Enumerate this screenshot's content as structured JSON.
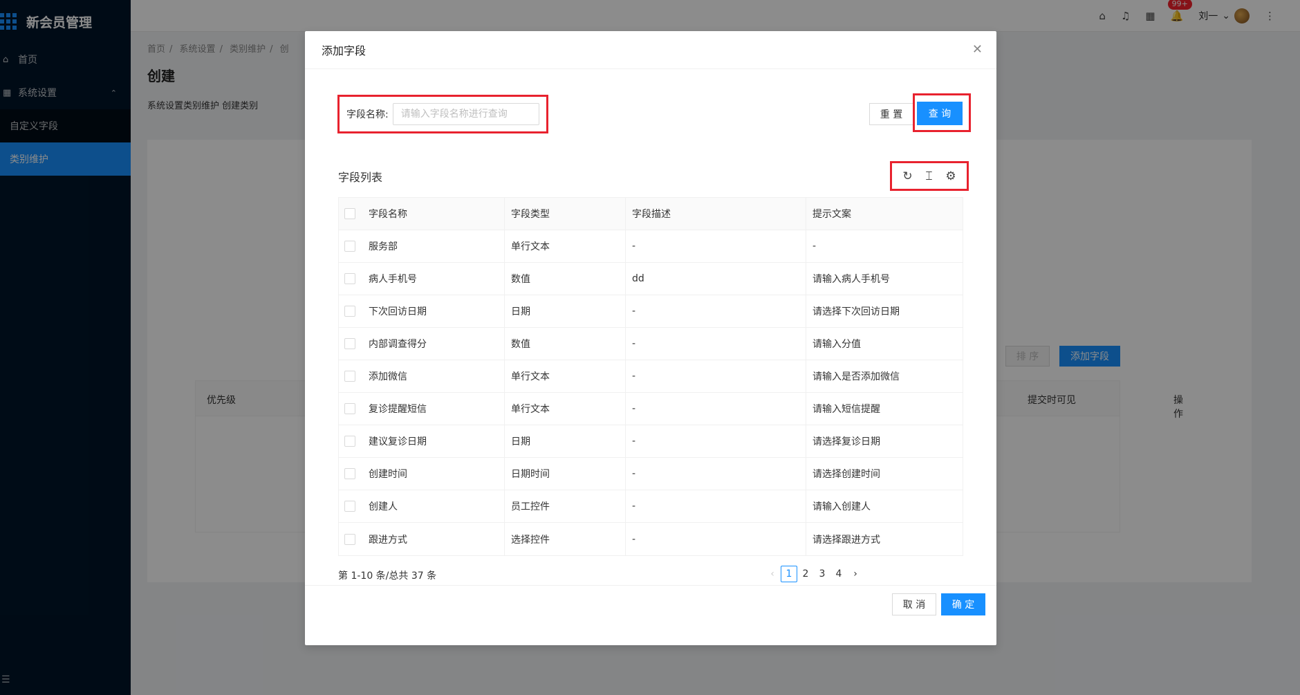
{
  "app": {
    "title": "新会员管理"
  },
  "sidebar": {
    "items": [
      {
        "label": "首页",
        "icon": "home-icon"
      },
      {
        "label": "系统设置",
        "icon": "settings-icon"
      },
      {
        "label": "自定义字段"
      },
      {
        "label": "类别维护"
      }
    ]
  },
  "header": {
    "badge": "99+",
    "user_name": "刘一"
  },
  "page": {
    "breadcrumb": [
      "首页",
      "系统设置",
      "类别维护",
      "创"
    ],
    "title": "创建",
    "subtitle": "系统设置类别维护 创建类别",
    "sort_label": "排 序",
    "add_field_label": "添加字段",
    "table_headers": {
      "priority": "优先级",
      "visible": "提交时可见",
      "action": "操作"
    }
  },
  "modal": {
    "title": "添加字段",
    "search": {
      "label": "字段名称:",
      "placeholder": "请输入字段名称进行查询",
      "value": ""
    },
    "reset_label": "重 置",
    "query_label": "查 询",
    "list_title": "字段列表",
    "columns": [
      "字段名称",
      "字段类型",
      "字段描述",
      "提示文案"
    ],
    "rows": [
      [
        "服务部",
        "单行文本",
        "-",
        "-"
      ],
      [
        "病人手机号",
        "数值",
        "dd",
        "请输入病人手机号"
      ],
      [
        "下次回访日期",
        "日期",
        "-",
        "请选择下次回访日期"
      ],
      [
        "内部调查得分",
        "数值",
        "-",
        "请输入分值"
      ],
      [
        "添加微信",
        "单行文本",
        "-",
        "请输入是否添加微信"
      ],
      [
        "复诊提醒短信",
        "单行文本",
        "-",
        "请输入短信提醒"
      ],
      [
        "建议复诊日期",
        "日期",
        "-",
        "请选择复诊日期"
      ],
      [
        "创建时间",
        "日期时间",
        "-",
        "请选择创建时间"
      ],
      [
        "创建人",
        "员工控件",
        "-",
        "请输入创建人"
      ],
      [
        "跟进方式",
        "选择控件",
        "-",
        "请选择跟进方式"
      ]
    ],
    "total": "第 1-10 条/总共 37 条",
    "pages": [
      "1",
      "2",
      "3",
      "4"
    ],
    "current_page": "1",
    "cancel_label": "取 消",
    "ok_label": "确 定"
  },
  "colors": {
    "primary": "#1890ff",
    "sidebar": "#001529",
    "highlight": "#e8222e"
  }
}
